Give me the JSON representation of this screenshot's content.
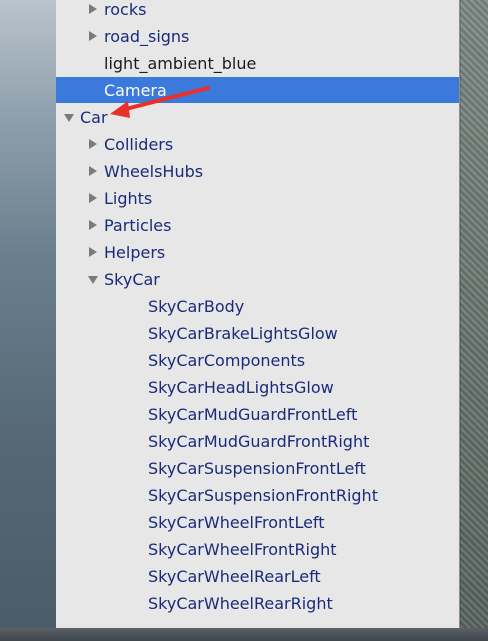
{
  "hierarchy": {
    "rows": [
      {
        "label": "rocks",
        "depth": 1,
        "toggle": "right"
      },
      {
        "label": "road_signs",
        "depth": 1,
        "toggle": "right"
      },
      {
        "label": "light_ambient_blue",
        "depth": 1,
        "toggle": "none"
      },
      {
        "label": "Camera",
        "depth": 1,
        "toggle": "none",
        "selected": true
      },
      {
        "label": "Car",
        "depth": 0,
        "toggle": "down"
      },
      {
        "label": "Colliders",
        "depth": 1,
        "toggle": "right"
      },
      {
        "label": "WheelsHubs",
        "depth": 1,
        "toggle": "right"
      },
      {
        "label": "Lights",
        "depth": 1,
        "toggle": "right"
      },
      {
        "label": "Particles",
        "depth": 1,
        "toggle": "right"
      },
      {
        "label": "Helpers",
        "depth": 1,
        "toggle": "right"
      },
      {
        "label": "SkyCar",
        "depth": 1,
        "toggle": "down"
      },
      {
        "label": "SkyCarBody",
        "depth": 2,
        "toggle": "none"
      },
      {
        "label": "SkyCarBrakeLightsGlow",
        "depth": 2,
        "toggle": "none"
      },
      {
        "label": "SkyCarComponents",
        "depth": 2,
        "toggle": "none"
      },
      {
        "label": "SkyCarHeadLightsGlow",
        "depth": 2,
        "toggle": "none"
      },
      {
        "label": "SkyCarMudGuardFrontLeft",
        "depth": 2,
        "toggle": "none"
      },
      {
        "label": "SkyCarMudGuardFrontRight",
        "depth": 2,
        "toggle": "none"
      },
      {
        "label": "SkyCarSuspensionFrontLeft",
        "depth": 2,
        "toggle": "none"
      },
      {
        "label": "SkyCarSuspensionFrontRight",
        "depth": 2,
        "toggle": "none"
      },
      {
        "label": "SkyCarWheelFrontLeft",
        "depth": 2,
        "toggle": "none"
      },
      {
        "label": "SkyCarWheelFrontRight",
        "depth": 2,
        "toggle": "none"
      },
      {
        "label": "SkyCarWheelRearLeft",
        "depth": 2,
        "toggle": "none"
      },
      {
        "label": "SkyCarWheelRearRight",
        "depth": 2,
        "toggle": "none"
      }
    ]
  },
  "colors": {
    "selection": "#3b79dc",
    "text_blue": "#1a2b7a",
    "text_dark": "#1b1b1b",
    "annotation_arrow": "#e8312a"
  },
  "icons": {
    "collapsed": "triangle-right-icon",
    "expanded": "triangle-down-icon",
    "annotation": "red-arrow-annotation"
  }
}
